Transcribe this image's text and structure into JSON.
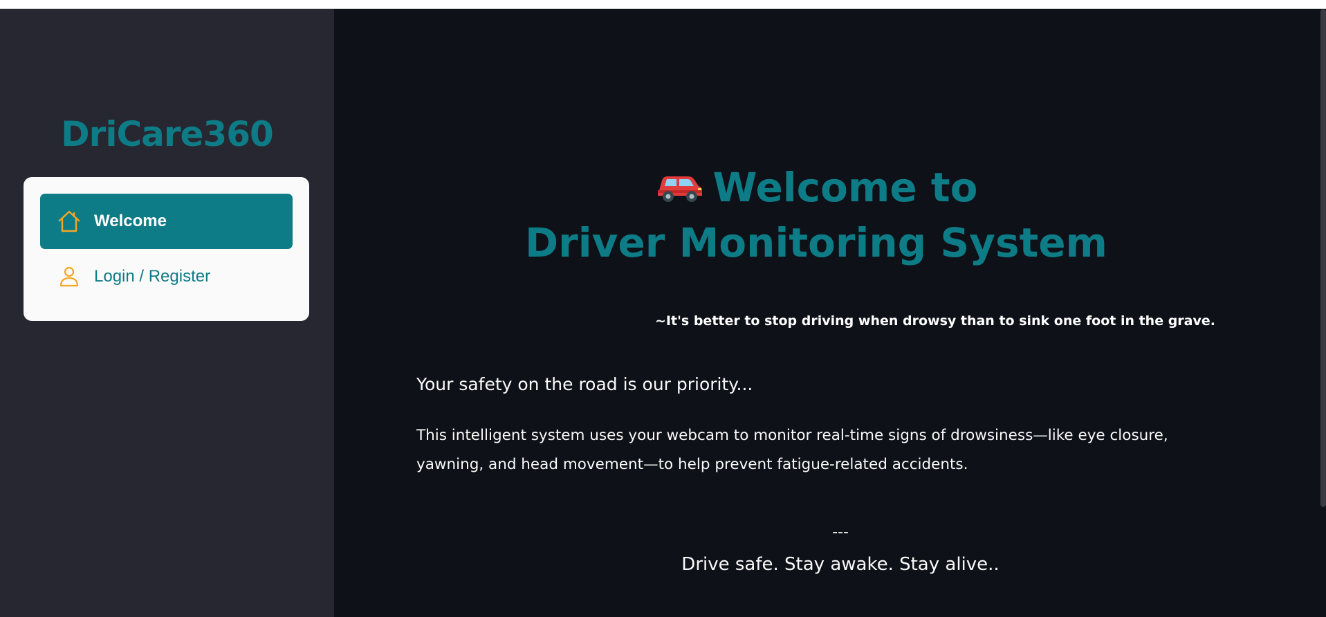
{
  "sidebar": {
    "brand": "DriCare360",
    "menu": [
      {
        "label": "Welcome",
        "icon": "home-icon",
        "active": true
      },
      {
        "label": "Login / Register",
        "icon": "user-icon",
        "active": false
      }
    ]
  },
  "main": {
    "hero_line1": "Welcome to",
    "hero_line2": "Driver Monitoring System",
    "hero_icon": "car-icon",
    "quote": "~It's better to stop driving when drowsy than to sink one foot in the grave.",
    "priority": "Your safety on the road is our priority...",
    "description": "This intelligent system uses your webcam to monitor real-time signs of drowsiness—like eye closure, yawning, and head movement—to help prevent fatigue-related accidents.",
    "divider": "---",
    "closing": "Drive safe. Stay awake. Stay alive.."
  },
  "colors": {
    "accent": "#0e7c86",
    "sidebar_bg": "#262730",
    "main_bg": "#0e1117",
    "icon_orange": "#f5a623",
    "card_bg": "#fafafa"
  }
}
